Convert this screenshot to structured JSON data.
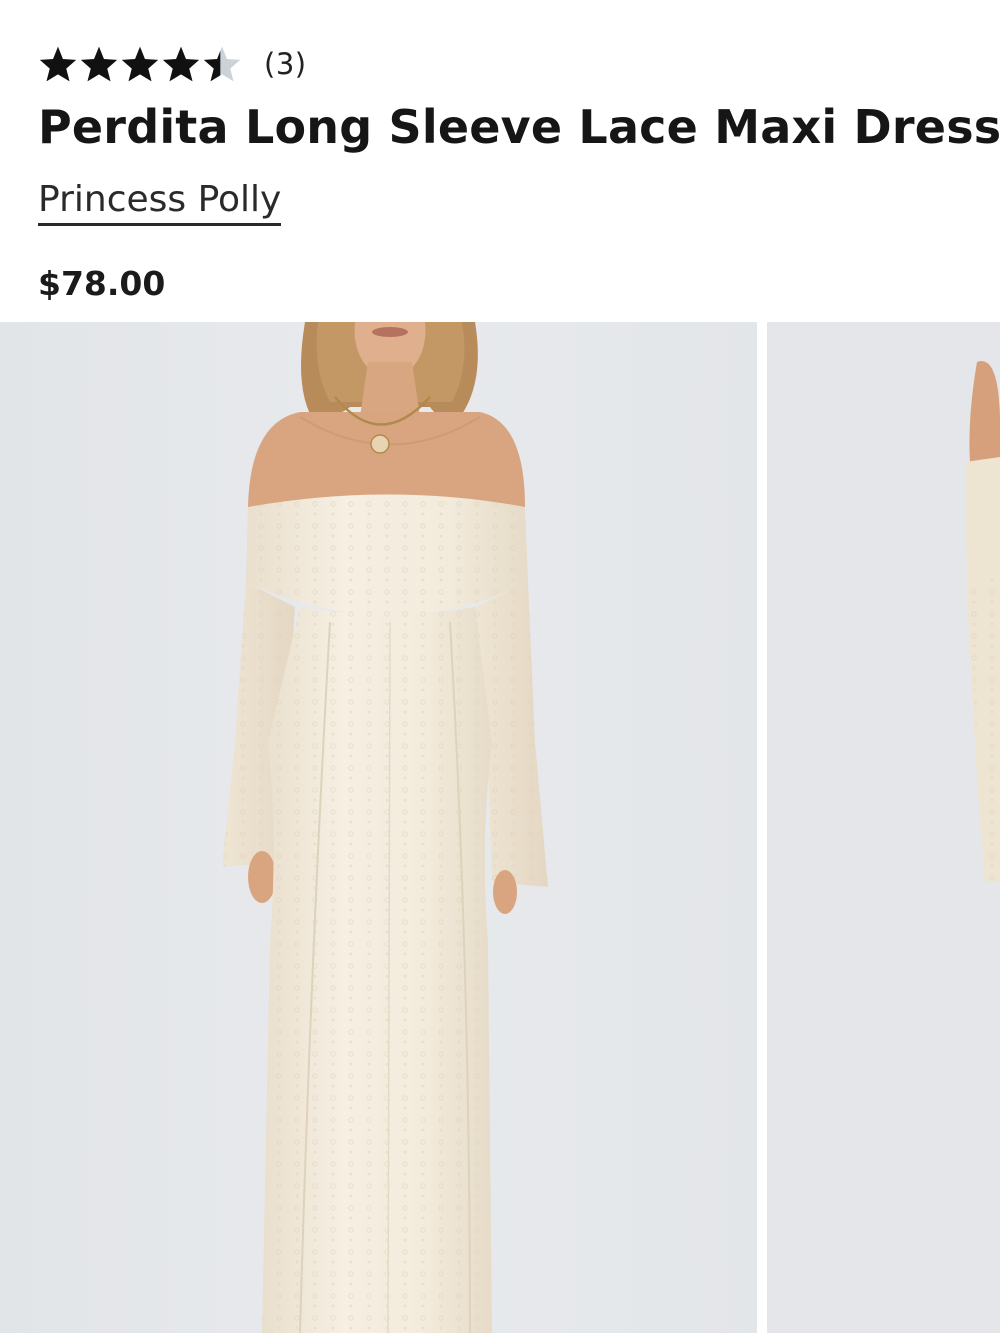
{
  "product": {
    "rating": {
      "value": 4.5,
      "max": 5,
      "count_label": "(3)"
    },
    "title": "Perdita Long Sleeve Lace Maxi Dress",
    "brand": "Princess Polly",
    "price": "$78.00"
  },
  "gallery": {
    "images": [
      {
        "alt": "Model wearing cream off-shoulder long sleeve lace maxi dress, front view"
      },
      {
        "alt": "Model wearing cream lace maxi dress, alternate view"
      }
    ]
  },
  "colors": {
    "star_filled": "#111111",
    "star_empty": "#cbd2d8",
    "photo_background": "#e5e7ea",
    "dress": "#f3ebdc"
  },
  "icons": {
    "star": "star-icon",
    "star_half": "star-half-icon"
  }
}
